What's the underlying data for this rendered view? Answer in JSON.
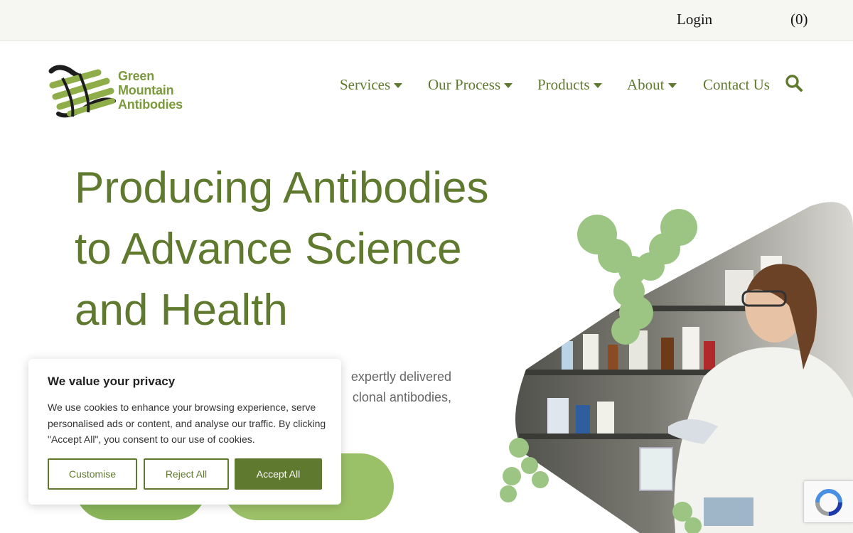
{
  "topbar": {
    "login": "Login",
    "cart": "(0)"
  },
  "brand": {
    "line1": "Green",
    "line2": "Mountain",
    "line3": "Antibodies"
  },
  "nav": {
    "services": "Services",
    "process": "Our Process",
    "products": "Products",
    "about": "About",
    "contact": "Contact Us"
  },
  "hero": {
    "title_line1": "Producing Antibodies",
    "title_line2": "to Advance Science",
    "title_line3": "and Health",
    "text_line1": "expertly delivered",
    "text_line2": "clonal antibodies,"
  },
  "cookie": {
    "title": "We value your privacy",
    "body": "We use cookies to enhance your browsing experience, serve personalised ads or content, and analyse our traffic. By clicking \"Accept All\", you consent to our use of cookies.",
    "customise": "Customise",
    "reject": "Reject All",
    "accept": "Accept All"
  },
  "colors": {
    "brand_green": "#5f7a2e",
    "light_green": "#8ab55a",
    "logo_green": "#7b9a3c"
  },
  "icons": {
    "search": "search-icon",
    "caret": "caret-down-icon",
    "recaptcha": "recaptcha-icon"
  }
}
